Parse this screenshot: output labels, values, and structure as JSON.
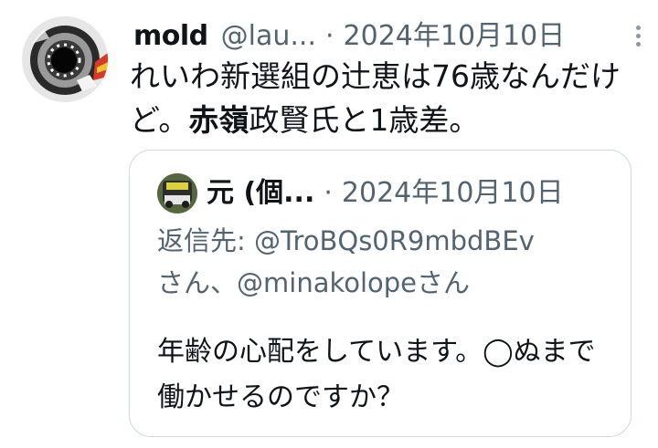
{
  "tweet": {
    "author_name": "mold",
    "handle": "@lau...",
    "separator": "·",
    "date": "2024年10月10日",
    "more_icon": "more-vertical-icon",
    "text_part1": "れいわ新選組の辻恵は76歳なんだけど。",
    "text_bold": "赤嶺",
    "text_part2": "政賢氏と1歳差。"
  },
  "quote": {
    "author_name": "元 (個...",
    "separator": "·",
    "date": "2024年10月10日",
    "reply_prefix": "返信先: ",
    "reply_mention1": "@TroBQs0R9mbdBEv",
    "reply_mid": "さん、",
    "reply_mention2": "@minakolope",
    "reply_suffix": "さん",
    "text": "年齢の心配をしています。◯ぬまで 働かせるのですか？"
  },
  "colors": {
    "text": "#0f1419",
    "secondary": "#536471",
    "border": "#cfd9de"
  }
}
